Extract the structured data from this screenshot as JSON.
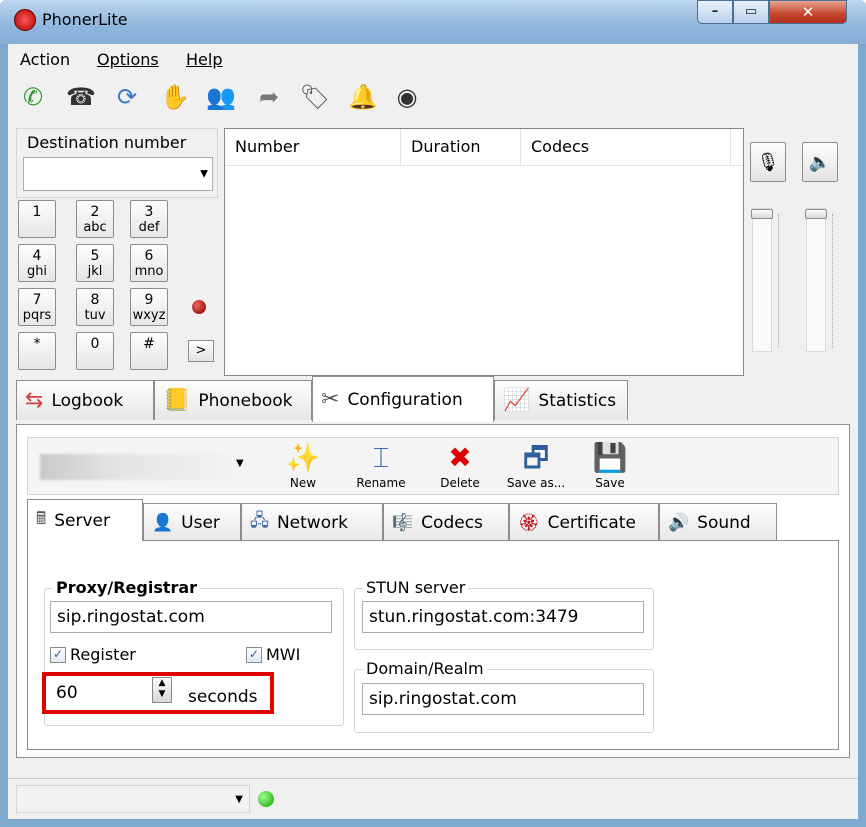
{
  "window": {
    "title": "PhonerLite",
    "min": "–",
    "max": "▭",
    "close": "✕"
  },
  "menu": [
    "Action",
    "Options",
    "Help"
  ],
  "destination": {
    "label": "Destination number",
    "value": ""
  },
  "keypad": [
    {
      "d": "1",
      "l": ""
    },
    {
      "d": "2",
      "l": "abc"
    },
    {
      "d": "3",
      "l": "def"
    },
    {
      "d": "4",
      "l": "ghi"
    },
    {
      "d": "5",
      "l": "jkl"
    },
    {
      "d": "6",
      "l": "mno"
    },
    {
      "d": "7",
      "l": "pqrs"
    },
    {
      "d": "8",
      "l": "tuv"
    },
    {
      "d": "9",
      "l": "wxyz"
    },
    {
      "d": "*",
      "l": ""
    },
    {
      "d": "0",
      "l": ""
    },
    {
      "d": "#",
      "l": ""
    }
  ],
  "keypad_more": ">",
  "call_list": {
    "columns": [
      "Number",
      "Duration",
      "Codecs"
    ]
  },
  "main_tabs": [
    "Logbook",
    "Phonebook",
    "Configuration",
    "Statistics"
  ],
  "profile_buttons": [
    "New",
    "Rename",
    "Delete",
    "Save as...",
    "Save"
  ],
  "sub_tabs": [
    "Server",
    "User",
    "Network",
    "Codecs",
    "Certificate",
    "Sound"
  ],
  "server": {
    "proxy_label": "Proxy/Registrar",
    "proxy_value": "sip.ringostat.com",
    "register_label": "Register",
    "register_checked": true,
    "mwi_label": "MWI",
    "mwi_checked": true,
    "interval_value": "60",
    "interval_unit": "seconds",
    "stun_label": "STUN server",
    "stun_value": "stun.ringostat.com:3479",
    "domain_label": "Domain/Realm",
    "domain_value": "sip.ringostat.com"
  },
  "check_mark": "✓"
}
